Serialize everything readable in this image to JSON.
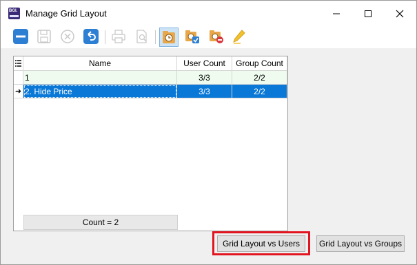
{
  "window": {
    "title": "Manage Grid Layout",
    "controls": [
      "minimize-icon",
      "maximize-icon",
      "close-icon"
    ]
  },
  "toolbar": {
    "buttons": [
      {
        "name": "remove",
        "icon": "minus-circle-icon",
        "enabled": true
      },
      {
        "name": "save",
        "icon": "save-icon",
        "enabled": false
      },
      {
        "name": "cancel",
        "icon": "cancel-icon",
        "enabled": false
      },
      {
        "name": "undo",
        "icon": "undo-icon",
        "enabled": true
      },
      {
        "name": "print",
        "icon": "print-icon",
        "enabled": false
      },
      {
        "name": "print-preview",
        "icon": "print-preview-icon",
        "enabled": false
      },
      {
        "name": "layout",
        "icon": "clock-folder-icon",
        "enabled": true,
        "active": true
      },
      {
        "name": "layout-check",
        "icon": "folder-check-icon",
        "enabled": true
      },
      {
        "name": "layout-remove",
        "icon": "folder-remove-icon",
        "enabled": true
      },
      {
        "name": "edit",
        "icon": "pencil-icon",
        "enabled": true
      }
    ]
  },
  "grid": {
    "columns": [
      "Name",
      "User Count",
      "Group Count"
    ],
    "rows": [
      {
        "indicator": "",
        "name": "1",
        "user_count": "3/3",
        "group_count": "2/2",
        "selected": false
      },
      {
        "indicator": "➜",
        "name": "2. Hide Price",
        "user_count": "3/3",
        "group_count": "2/2",
        "selected": true
      }
    ],
    "footer": "Count = 2"
  },
  "buttons": {
    "vs_users": "Grid Layout vs Users",
    "vs_groups": "Grid Layout vs Groups"
  },
  "colors": {
    "selection": "#0a78d7",
    "row_bg": "#eefbee",
    "highlight_box": "#e2141f",
    "toolbar_icon": "#2d7fd3"
  }
}
